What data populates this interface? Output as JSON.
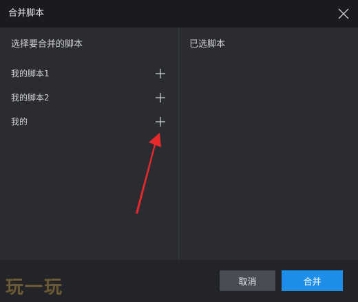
{
  "dialog": {
    "title": "合并脚本"
  },
  "left_panel": {
    "heading": "选择要合并的脚本",
    "items": [
      {
        "name": "我的脚本1"
      },
      {
        "name": "我的脚本2"
      },
      {
        "name": "我的"
      }
    ]
  },
  "right_panel": {
    "heading": "已选脚本"
  },
  "footer": {
    "cancel_label": "取消",
    "merge_label": "合并"
  },
  "watermark": {
    "text": "玩一玩"
  },
  "icons": {
    "close": "close-icon",
    "add": "plus-icon",
    "annotation": "red-arrow"
  },
  "colors": {
    "titlebar_bg": "#1a1b1f",
    "panel_bg": "#2a2c32",
    "footer_bg": "#222429",
    "primary_button": "#1e8fe8",
    "secondary_button": "#4a4c53",
    "annotation_arrow": "#e8282b"
  }
}
